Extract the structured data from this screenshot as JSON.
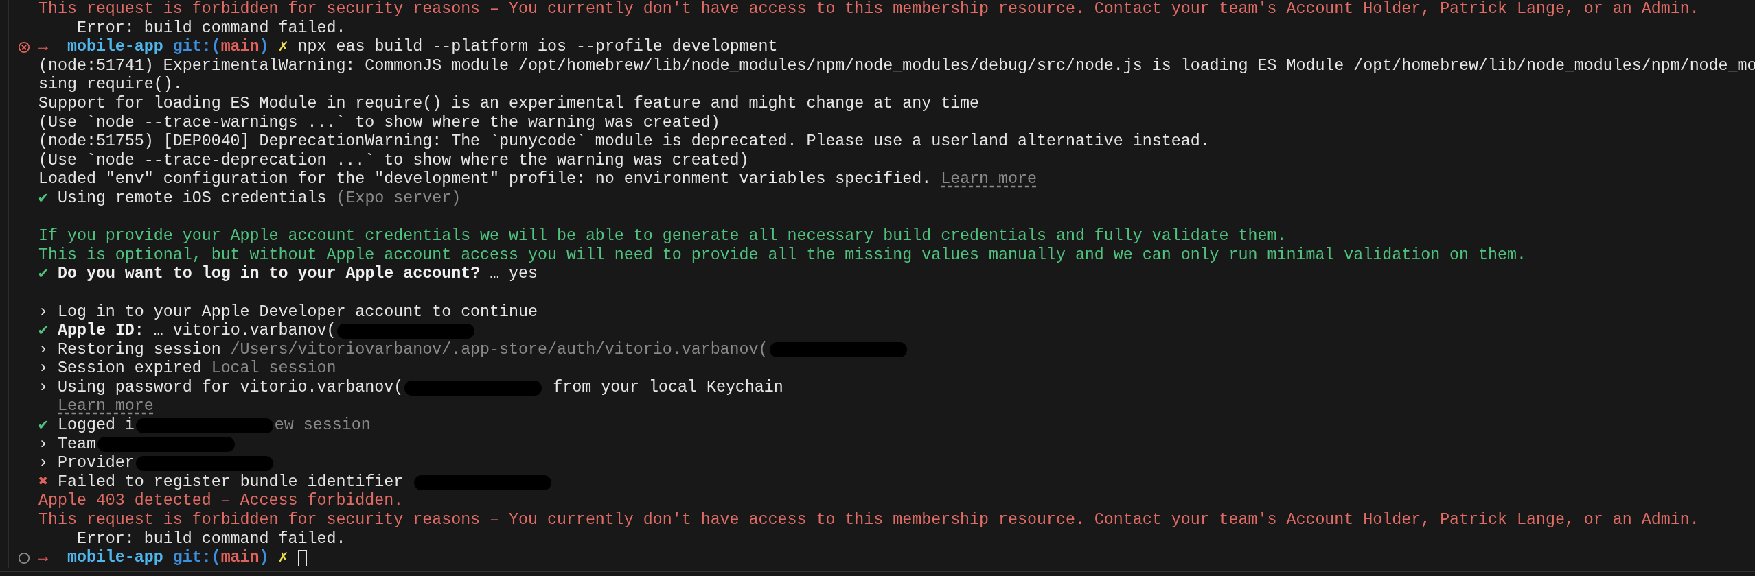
{
  "terminal": {
    "lines": [
      {
        "segments": [
          {
            "text": "This request is forbidden for security reasons – You currently don't have access to this membership resource. Contact your team's Account Holder, Patrick Lange, or an Admin.",
            "kind": "error"
          }
        ]
      },
      {
        "segments": [
          {
            "text": "    Error: build command failed.",
            "kind": "plain"
          }
        ]
      },
      {
        "kind": "prompt",
        "failed": true,
        "segments": [
          {
            "text": "→",
            "kind": "arrow"
          },
          {
            "text": "  mobile-app",
            "kind": "dir"
          },
          {
            "text": " git:(",
            "kind": "git"
          },
          {
            "text": "main",
            "kind": "branch"
          },
          {
            "text": ")",
            "kind": "git"
          },
          {
            "text": " ✗",
            "kind": "dirty"
          },
          {
            "text": " npx eas build --platform ios --profile development",
            "kind": "plain"
          }
        ]
      },
      {
        "segments": [
          {
            "text": "(node:51741) ExperimentalWarning: CommonJS module /opt/homebrew/lib/node_modules/npm/node_modules/debug/src/node.js is loading ES Module /opt/homebrew/lib/node_modules/npm/node_mo",
            "kind": "plain"
          }
        ]
      },
      {
        "segments": [
          {
            "text": "sing require().",
            "kind": "plain"
          }
        ]
      },
      {
        "segments": [
          {
            "text": "Support for loading ES Module in require() is an experimental feature and might change at any time",
            "kind": "plain"
          }
        ]
      },
      {
        "segments": [
          {
            "text": "(Use `node --trace-warnings ...` to show where the warning was created)",
            "kind": "plain"
          }
        ]
      },
      {
        "segments": [
          {
            "text": "(node:51755) [DEP0040] DeprecationWarning: The `punycode` module is deprecated. Please use a userland alternative instead.",
            "kind": "plain"
          }
        ]
      },
      {
        "segments": [
          {
            "text": "(Use `node --trace-deprecation ...` to show where the warning was created)",
            "kind": "plain"
          }
        ]
      },
      {
        "segments": [
          {
            "text": "Loaded \"env\" configuration for the \"development\" profile: no environment variables specified. ",
            "kind": "plain"
          },
          {
            "text": "Learn more",
            "kind": "link"
          }
        ]
      },
      {
        "segments": [
          {
            "text": "✔",
            "kind": "ok"
          },
          {
            "text": " Using remote iOS credentials ",
            "kind": "plain"
          },
          {
            "text": "(Expo server)",
            "kind": "dim"
          }
        ]
      },
      {
        "kind": "blank"
      },
      {
        "segments": [
          {
            "text": "If you provide your Apple account credentials we will be able to generate all necessary build credentials and fully validate them.",
            "kind": "info"
          }
        ]
      },
      {
        "segments": [
          {
            "text": "This is optional, but without Apple account access you will need to provide all the missing values manually and we can only run minimal validation on them.",
            "kind": "info"
          }
        ]
      },
      {
        "segments": [
          {
            "text": "✔",
            "kind": "ok"
          },
          {
            "text": " Do you want to log in to your Apple account?",
            "kind": "bold"
          },
          {
            "text": " … yes",
            "kind": "plain"
          }
        ]
      },
      {
        "kind": "blank"
      },
      {
        "segments": [
          {
            "text": "› Log in to your Apple Developer account to continue",
            "kind": "plain"
          }
        ]
      },
      {
        "segments": [
          {
            "text": "✔",
            "kind": "ok"
          },
          {
            "text": " Apple ID:",
            "kind": "bold"
          },
          {
            "text": " … vitorio.varbanov(",
            "kind": "plain"
          },
          {
            "kind": "redaction"
          }
        ]
      },
      {
        "segments": [
          {
            "text": "› Restoring session ",
            "kind": "plain"
          },
          {
            "text": "/Users/vitoriovarbanov/.app-store/auth/vitorio.varbanov(",
            "kind": "dim"
          },
          {
            "kind": "redaction"
          }
        ]
      },
      {
        "segments": [
          {
            "text": "› Session expired ",
            "kind": "plain"
          },
          {
            "text": "Local session",
            "kind": "dim"
          }
        ]
      },
      {
        "segments": [
          {
            "text": "› Using password for vitorio.varbanov(",
            "kind": "plain"
          },
          {
            "kind": "redaction"
          },
          {
            "text": " from your local Keychain",
            "kind": "plain"
          }
        ]
      },
      {
        "kind": "continuation",
        "segments": [
          {
            "text": "Learn more",
            "kind": "link"
          }
        ]
      },
      {
        "segments": [
          {
            "text": "✔",
            "kind": "ok"
          },
          {
            "text": " Logged i",
            "kind": "plain"
          },
          {
            "kind": "redaction"
          },
          {
            "text": "ew session",
            "kind": "dim"
          }
        ]
      },
      {
        "segments": [
          {
            "text": "› Team",
            "kind": "plain"
          },
          {
            "kind": "redaction"
          }
        ]
      },
      {
        "segments": [
          {
            "text": "› Provider",
            "kind": "plain"
          },
          {
            "kind": "redaction"
          }
        ]
      },
      {
        "segments": [
          {
            "text": "✖",
            "kind": "fail"
          },
          {
            "text": " Failed to register bundle identifier ",
            "kind": "plain"
          },
          {
            "kind": "redaction"
          }
        ]
      },
      {
        "segments": [
          {
            "text": "Apple 403 detected – Access forbidden.",
            "kind": "error"
          }
        ]
      },
      {
        "segments": [
          {
            "text": "This request is forbidden for security reasons – You currently don't have access to this membership resource. Contact your team's Account Holder, Patrick Lange, or an Admin.",
            "kind": "error"
          }
        ]
      },
      {
        "segments": [
          {
            "text": "    Error: build command failed.",
            "kind": "plain"
          }
        ]
      },
      {
        "kind": "prompt",
        "failed": false,
        "cursor": true,
        "segments": [
          {
            "text": "→",
            "kind": "arrow"
          },
          {
            "text": "  mobile-app",
            "kind": "dir"
          },
          {
            "text": " git:(",
            "kind": "git"
          },
          {
            "text": "main",
            "kind": "branch"
          },
          {
            "text": ")",
            "kind": "git"
          },
          {
            "text": " ✗",
            "kind": "dirty"
          }
        ]
      }
    ]
  }
}
